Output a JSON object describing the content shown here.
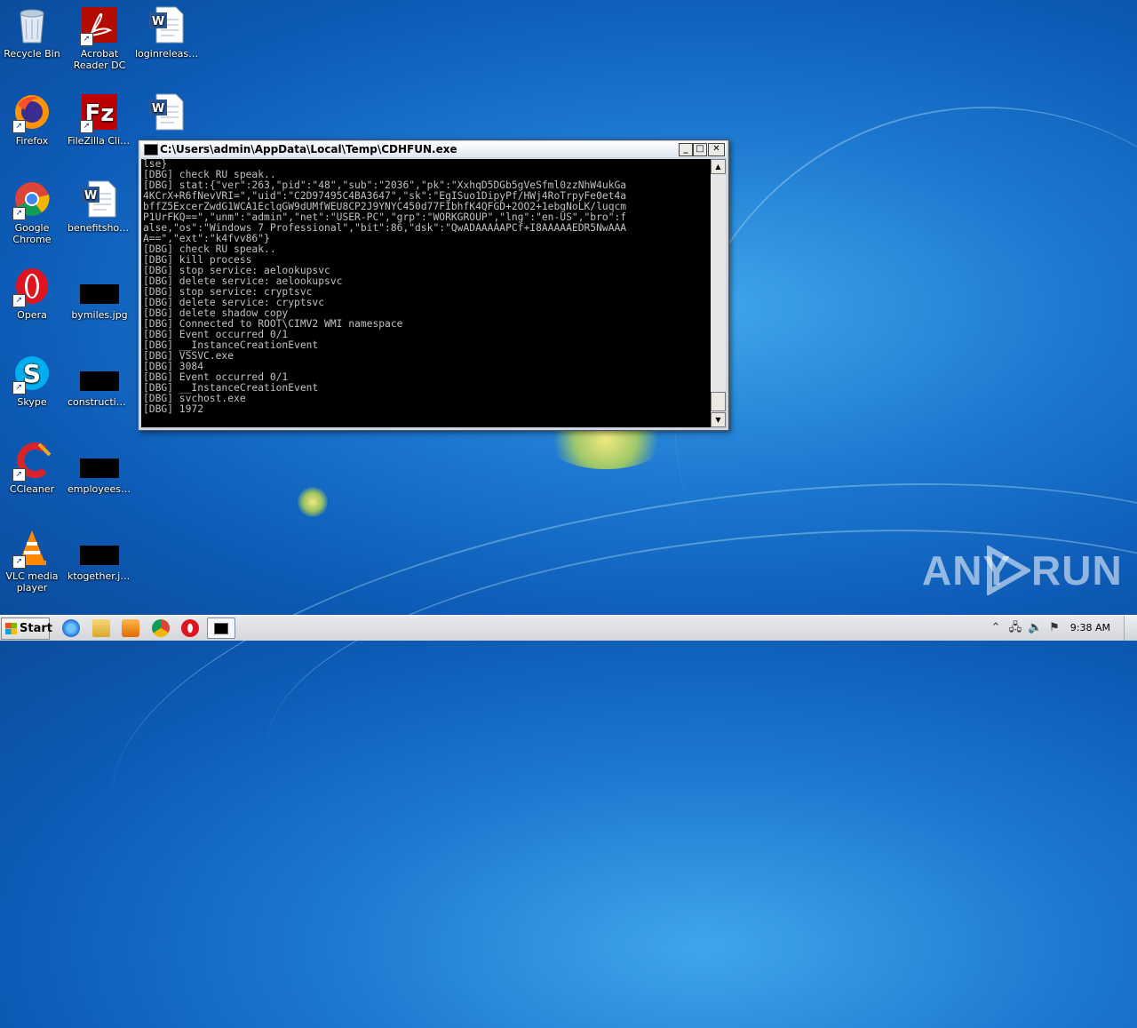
{
  "desktop": {
    "icons": [
      {
        "label": "Recycle Bin",
        "icon": "recycle-bin-icon"
      },
      {
        "label": "Acrobat Reader DC",
        "icon": "acrobat-icon"
      },
      {
        "label": "loginrelease....",
        "icon": "word-document-icon"
      },
      {
        "label": "Firefox",
        "icon": "firefox-icon"
      },
      {
        "label": "FileZilla Client",
        "icon": "filezilla-icon"
      },
      {
        "label": "",
        "icon": "word-document-icon"
      },
      {
        "label": "Google Chrome",
        "icon": "chrome-icon"
      },
      {
        "label": "benefitshos....",
        "icon": "word-document-icon"
      },
      {
        "label": "Opera",
        "icon": "opera-icon"
      },
      {
        "label": "bymiles.jpg",
        "icon": "image-thumbnail"
      },
      {
        "label": "Skype",
        "icon": "skype-icon"
      },
      {
        "label": "constructio....",
        "icon": "image-thumbnail"
      },
      {
        "label": "CCleaner",
        "icon": "ccleaner-icon"
      },
      {
        "label": "employeesu....",
        "icon": "image-thumbnail"
      },
      {
        "label": "VLC media player",
        "icon": "vlc-icon"
      },
      {
        "label": "ktogether.jpg",
        "icon": "image-thumbnail"
      }
    ]
  },
  "console_window": {
    "title": "C:\\Users\\admin\\AppData\\Local\\Temp\\CDHFUN.exe",
    "lines": [
      "lse}",
      "[DBG] check RU speak..",
      "[DBG] stat:{\"ver\":263,\"pid\":\"48\",\"sub\":\"2036\",\"pk\":\"XxhqD5DGb5gVeSfml0zzNhW4ukGa",
      "4KCrX+R6fNevVRI=\",\"uid\":\"C2D97495C4BA3647\",\"sk\":\"EgISuo1DipyPf/HWj4RoTrpyFe0et4a",
      "bffZ5ExcerZwdG1WCA1EclqGW9dUMfWEU8CP2J9YNYC450d77FIbhfK4QFGD+2OO2+1ebgNoLK/luqcm",
      "P1UrFKQ==\",\"unm\":\"admin\",\"net\":\"USER-PC\",\"grp\":\"WORKGROUP\",\"lng\":\"en-US\",\"bro\":f",
      "alse,\"os\":\"Windows 7 Professional\",\"bit\":86,\"dsk\":\"QwADAAAAAPCf+I8AAAAAEDR5NwAAA",
      "A==\",\"ext\":\"k4fvv86\"}",
      "[DBG] check RU speak..",
      "[DBG] kill process",
      "[DBG] stop service: aelookupsvc",
      "[DBG] delete service: aelookupsvc",
      "[DBG] stop service: cryptsvc",
      "[DBG] delete service: cryptsvc",
      "[DBG] delete shadow copy",
      "[DBG] Connected to ROOT\\CIMV2 WMI namespace",
      "[DBG] Event occurred 0/1",
      "[DBG] __InstanceCreationEvent",
      "[DBG] VSSVC.exe",
      "[DBG] 3084",
      "[DBG] Event occurred 0/1",
      "[DBG] __InstanceCreationEvent",
      "[DBG] svchost.exe",
      "[DBG] 1972"
    ]
  },
  "taskbar": {
    "start_label": "Start",
    "pinned": [
      "ie-icon",
      "explorer-icon",
      "media-player-icon",
      "chrome-icon",
      "opera-icon",
      "console-icon"
    ],
    "tray_icons": [
      "show-hidden-icon",
      "network-icon",
      "volume-icon",
      "flag-icon",
      "power-icon"
    ],
    "clock": "9:38 AM"
  },
  "watermark": {
    "left": "ANY",
    "right": "RUN"
  }
}
